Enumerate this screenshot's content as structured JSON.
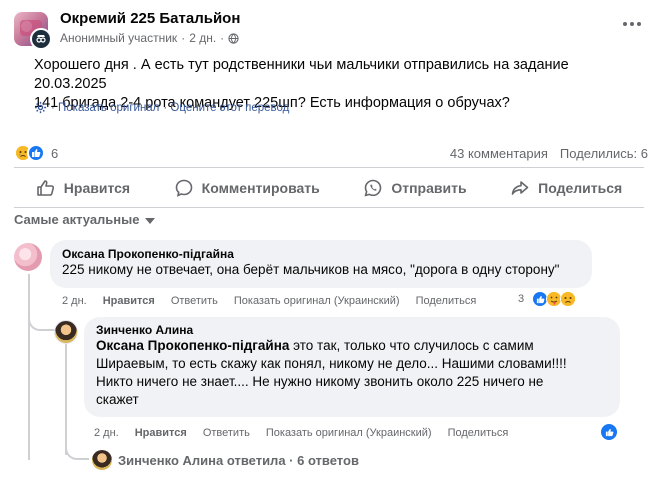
{
  "header": {
    "group_name": "Окремий 225 Батальйон",
    "author": "Анонимный участник",
    "separator": "·",
    "time": "2 дн.",
    "separator2": "·"
  },
  "post": {
    "text_line1": "Хорошего дня . А есть тут родственники чьи мальчики отправились на задание 20.03.2025",
    "text_line2": "141 бригада 2-4 рота командует 225шп? Есть информация о обручах?",
    "show_original": "· Показать оригинал",
    "rate_translation": "· Оцените этот перевод"
  },
  "stats": {
    "reaction_count": "6",
    "comments": "43 комментария",
    "shares": "Поделились: 6"
  },
  "actions": {
    "like": "Нравится",
    "comment": "Комментировать",
    "send": "Отправить",
    "share": "Поделиться"
  },
  "sort": {
    "label": "Самые актуальные"
  },
  "comments": [
    {
      "author": "Оксана Прокопенко-підгайна",
      "text": "225 никому не отвечает, она берёт мальчиков на мясо, \"дорога в одну сторону\"",
      "time": "2 дн.",
      "like": "Нравится",
      "reply": "Ответить",
      "show_original": "Показать оригинал (Украинский)",
      "share": "Поделиться",
      "reaction_count": "3"
    },
    {
      "author": "Зинченко Алина",
      "mention": "Оксана Прокопенко-підгайна",
      "text_after_mention": " это так, только что случилось с самим",
      "text_line2": "Шираевым, то есть скажу как понял, никому не дело... Нашими словами!!!!",
      "text_line3": "Никто ничего не знает.... Не нужно никому звонить около 225 ничего не",
      "text_line4": "скажет",
      "time": "2 дн.",
      "like": "Нравится",
      "reply": "Ответить",
      "show_original": "Показать оригинал (Украинский)",
      "share": "Поделиться"
    }
  ],
  "replies": {
    "label": "Зинченко Алина ответила · 6 ответов"
  },
  "colors": {
    "like_blue": "#1877f2",
    "muted": "#65676b",
    "bubble": "#f0f2f5",
    "link": "#385898"
  }
}
